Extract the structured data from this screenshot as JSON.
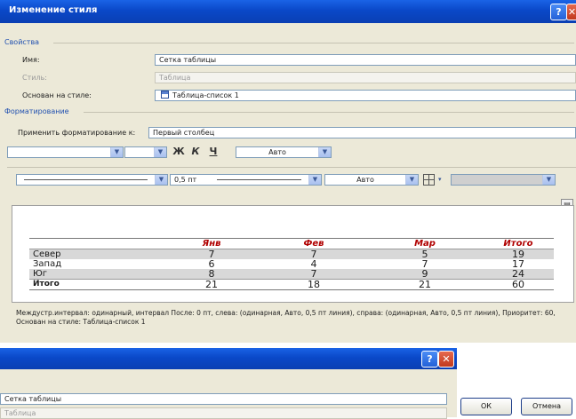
{
  "window": {
    "title": "Изменение стиля",
    "help": "?",
    "close": "✕"
  },
  "properties": {
    "section": "Свойства",
    "name_label": "Имя:",
    "name_value": "Сетка таблицы",
    "type_label": "Стиль:",
    "type_value": "Таблица",
    "based_label": "Основан на стиле:",
    "based_value": "Таблица-список 1",
    "based_icon": "table-icon"
  },
  "formatting": {
    "section": "Форматирование",
    "apply_label": "Применить форматирование к:",
    "apply_value": "Первый столбец",
    "bold": "Ж",
    "italic": "К",
    "underline": "Ч",
    "font_color": "Авто",
    "line_width": "0,5 пт",
    "border_color": "Авто"
  },
  "preview": {
    "headers": [
      "",
      "Янв",
      "Фев",
      "Мар",
      "Итого"
    ],
    "rows": [
      [
        "Север",
        "7",
        "7",
        "5",
        "19"
      ],
      [
        "Запад",
        "6",
        "4",
        "7",
        "17"
      ],
      [
        "Юг",
        "8",
        "7",
        "9",
        "24"
      ],
      [
        "Итого",
        "21",
        "18",
        "21",
        "60"
      ]
    ]
  },
  "description": "Междустр.интервал: одинарный, интервал После: 0 пт, слева: (одинарная, Авто, 0,5 пт линия), справа: (одинарная, Авто, 0,5 пт линия), Приоритет: 60, Основан на стиле: Таблица-список 1",
  "second_dialog": {
    "name_value": "Сетка таблицы",
    "type_value": "Таблица",
    "help": "?",
    "close": "✕"
  },
  "buttons": {
    "ok": "ОК",
    "cancel": "Отмена"
  }
}
